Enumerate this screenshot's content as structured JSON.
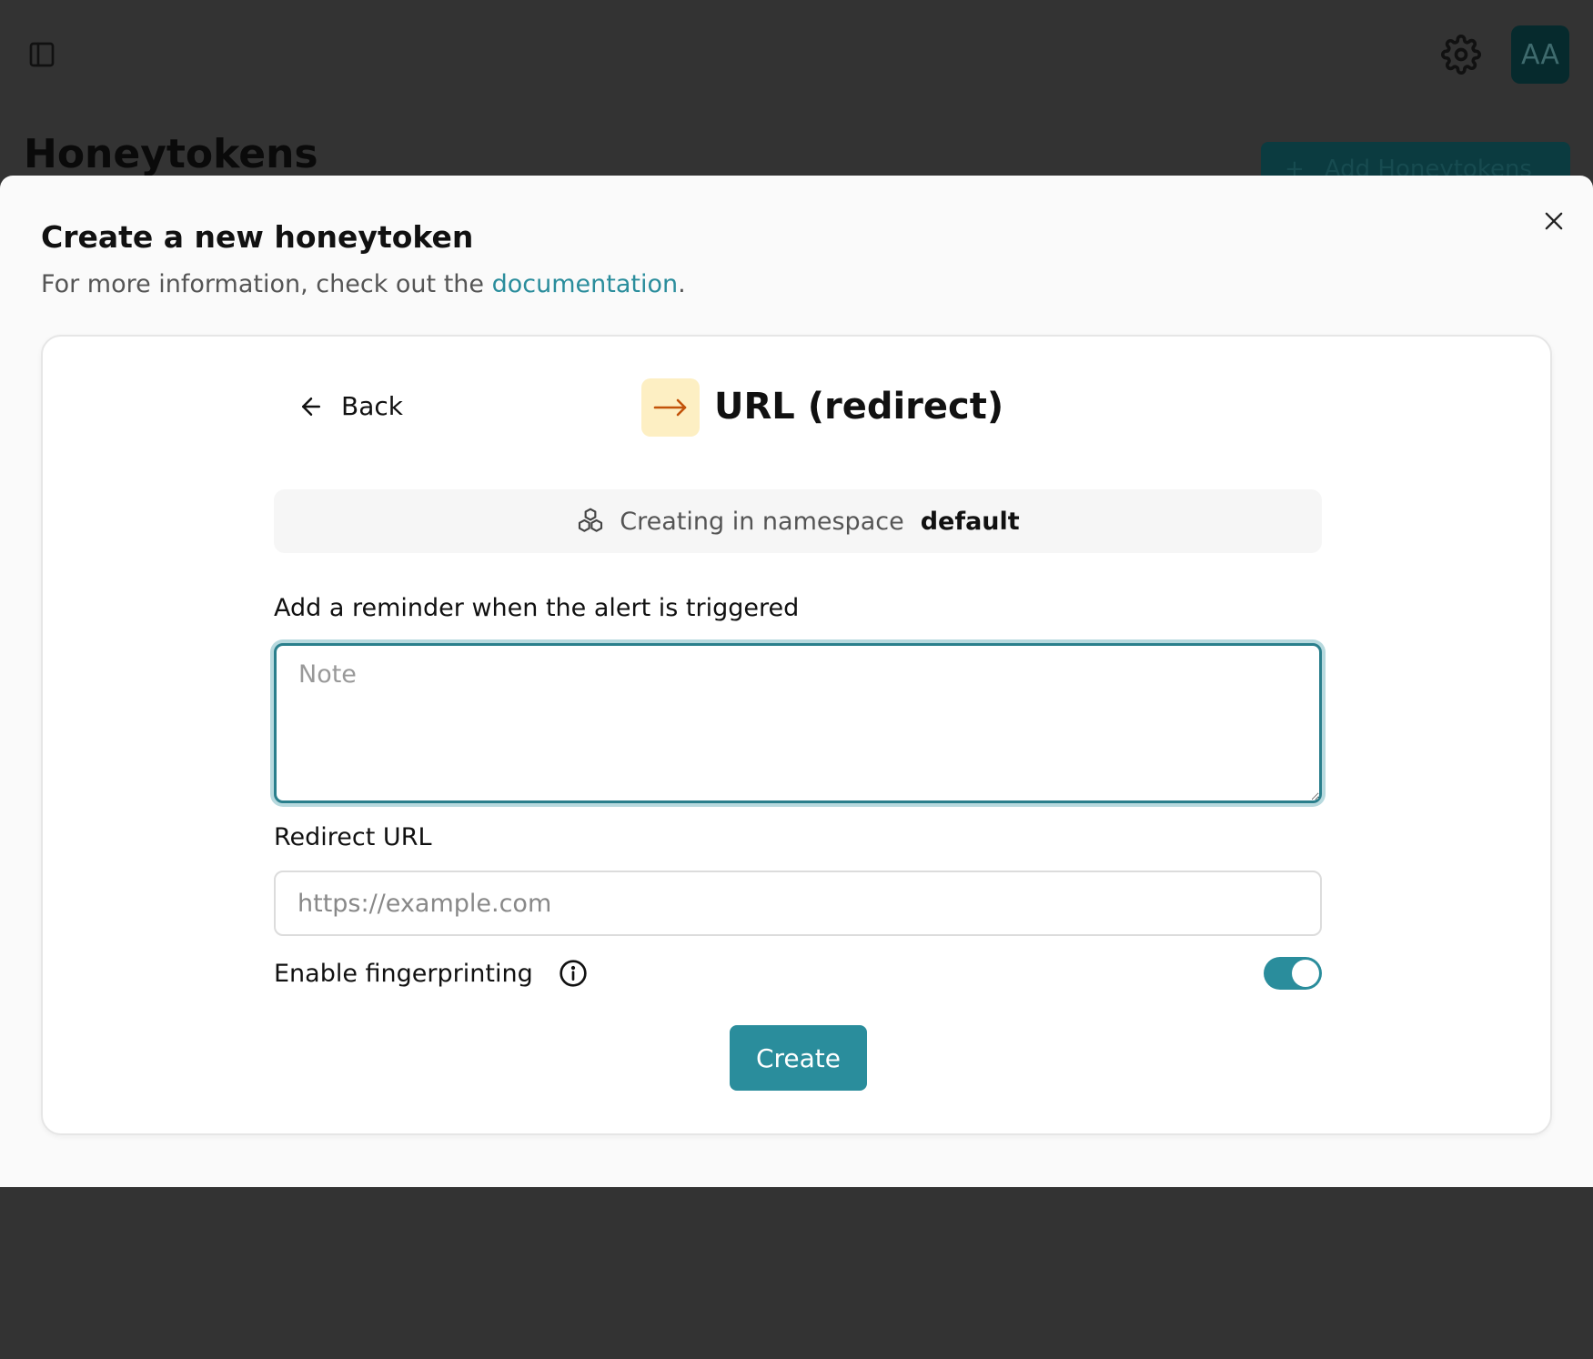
{
  "app": {
    "page_title": "Honeytokens",
    "add_button_label": "Add Honeytokens",
    "avatar_initials": "AA"
  },
  "modal": {
    "title": "Create a new honeytoken",
    "subtitle_prefix": "For more information, check out the ",
    "subtitle_link": "documentation",
    "subtitle_suffix": ".",
    "back_label": "Back",
    "type_title": "URL (redirect)",
    "namespace_label": "Creating in namespace",
    "namespace_value": "default",
    "reminder_label": "Add a reminder when the alert is triggered",
    "note_placeholder": "Note",
    "redirect_label": "Redirect URL",
    "redirect_placeholder": "https://example.com",
    "fingerprint_label": "Enable fingerprinting",
    "fingerprint_enabled": true,
    "create_label": "Create"
  },
  "colors": {
    "accent": "#2a8d9c",
    "type_icon_bg": "#fdefc3",
    "type_icon_fg": "#c2530a",
    "backdrop": "#333333"
  },
  "icons": {
    "sidebar": "sidebar-toggle-icon",
    "settings": "gear-icon",
    "close": "close-icon",
    "back": "arrow-left-icon",
    "type": "arrow-right-icon",
    "namespace": "cubes-icon",
    "info": "info-icon"
  }
}
